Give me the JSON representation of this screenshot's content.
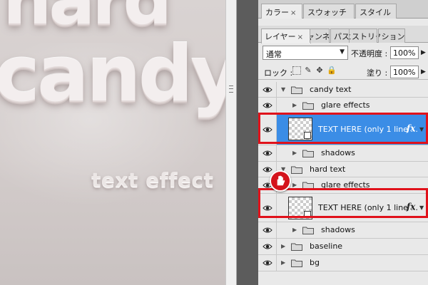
{
  "canvas": {
    "candy_top": "hard",
    "candy_main": "candy",
    "small_text": "text effect"
  },
  "panel_top_tabs": [
    {
      "label": "カラー",
      "close": "×"
    },
    {
      "label": "スウォッチ"
    },
    {
      "label": "スタイル"
    }
  ],
  "layers_tabs": [
    {
      "label": "レイヤー",
      "close": "×"
    },
    {
      "label": "チャンネル"
    },
    {
      "label": "パス"
    },
    {
      "label": "ヒストリー"
    },
    {
      "label": "アクション"
    }
  ],
  "blend": {
    "mode": "通常",
    "opacity_label": "不透明度 :",
    "opacity_value": "100%"
  },
  "lock": {
    "label": "ロック :",
    "fill_label": "塗り :",
    "fill_value": "100%"
  },
  "layers": [
    {
      "name": "candy text",
      "type": "group",
      "expanded": true,
      "indent": 0
    },
    {
      "name": "glare effects",
      "type": "group",
      "expanded": false,
      "indent": 1
    },
    {
      "name": "TEXT HERE (only 1 line ...",
      "type": "smart-object",
      "selected": true,
      "fx": "fx"
    },
    {
      "name": "shadows",
      "type": "group",
      "expanded": false,
      "indent": 1
    },
    {
      "name": "hard text",
      "type": "group",
      "expanded": true,
      "indent": 0
    },
    {
      "name": "glare effects",
      "type": "group",
      "expanded": false,
      "indent": 1
    },
    {
      "name": "TEXT HERE (only 1 line ...",
      "type": "smart-object",
      "selected": false,
      "fx": "fx"
    },
    {
      "name": "shadows",
      "type": "group",
      "expanded": false,
      "indent": 1
    },
    {
      "name": "baseline",
      "type": "group",
      "expanded": false,
      "indent": 0
    },
    {
      "name": "bg",
      "type": "group",
      "expanded": false,
      "indent": 0
    }
  ],
  "colors": {
    "selection": "#3b8de6",
    "highlight": "#e0121b",
    "marker": "#d4131c"
  }
}
